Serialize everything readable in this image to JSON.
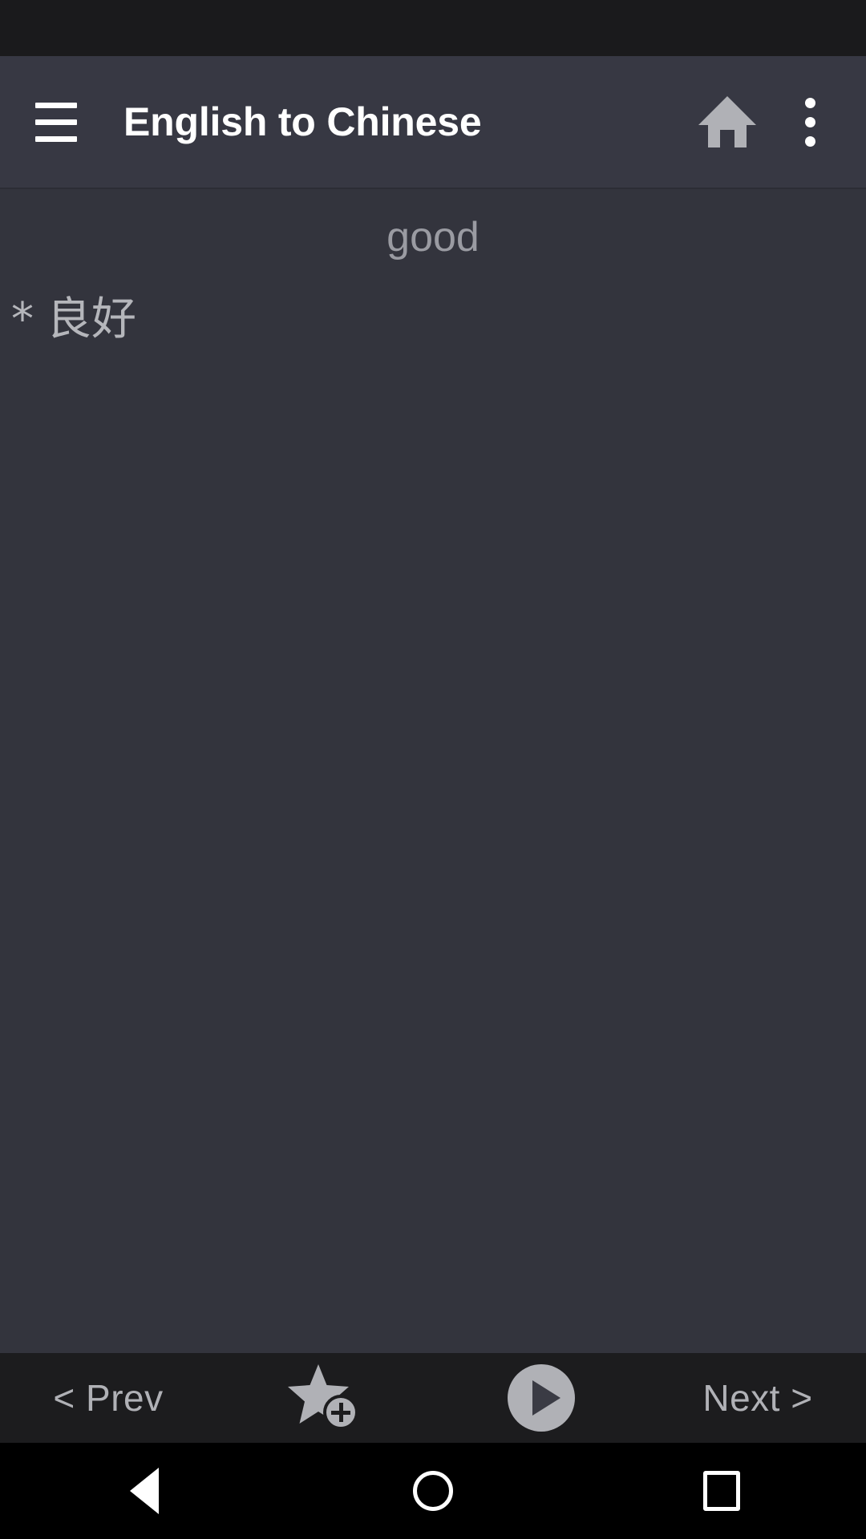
{
  "app": {
    "title": "English to Chinese"
  },
  "app_bar": {
    "menu_icon": "hamburger-menu-icon",
    "home_icon": "home-icon",
    "overflow_icon": "more-vertical-icon"
  },
  "content": {
    "headword": "good",
    "definitions": [
      {
        "bullet": "*",
        "text": "良好"
      }
    ]
  },
  "bottom_bar": {
    "prev_label": "< Prev",
    "favorite_icon": "star-plus-icon",
    "play_icon": "play-circle-icon",
    "next_label": "Next >"
  },
  "nav_bar": {
    "back_icon": "triangle-back-icon",
    "home_icon": "circle-home-icon",
    "recents_icon": "square-recents-icon"
  },
  "colors": {
    "status_bar": "#1a1a1c",
    "app_bar": "#373843",
    "content_bg": "#33343d",
    "bottom_bar": "#1c1c1e",
    "nav_bar": "#000000",
    "title_text": "#ffffff",
    "headword_text": "#9a9ba2",
    "definition_text": "#b5b6bb",
    "toolbar_text": "#b0b1b6",
    "icon_gray": "#b0b1b6"
  }
}
